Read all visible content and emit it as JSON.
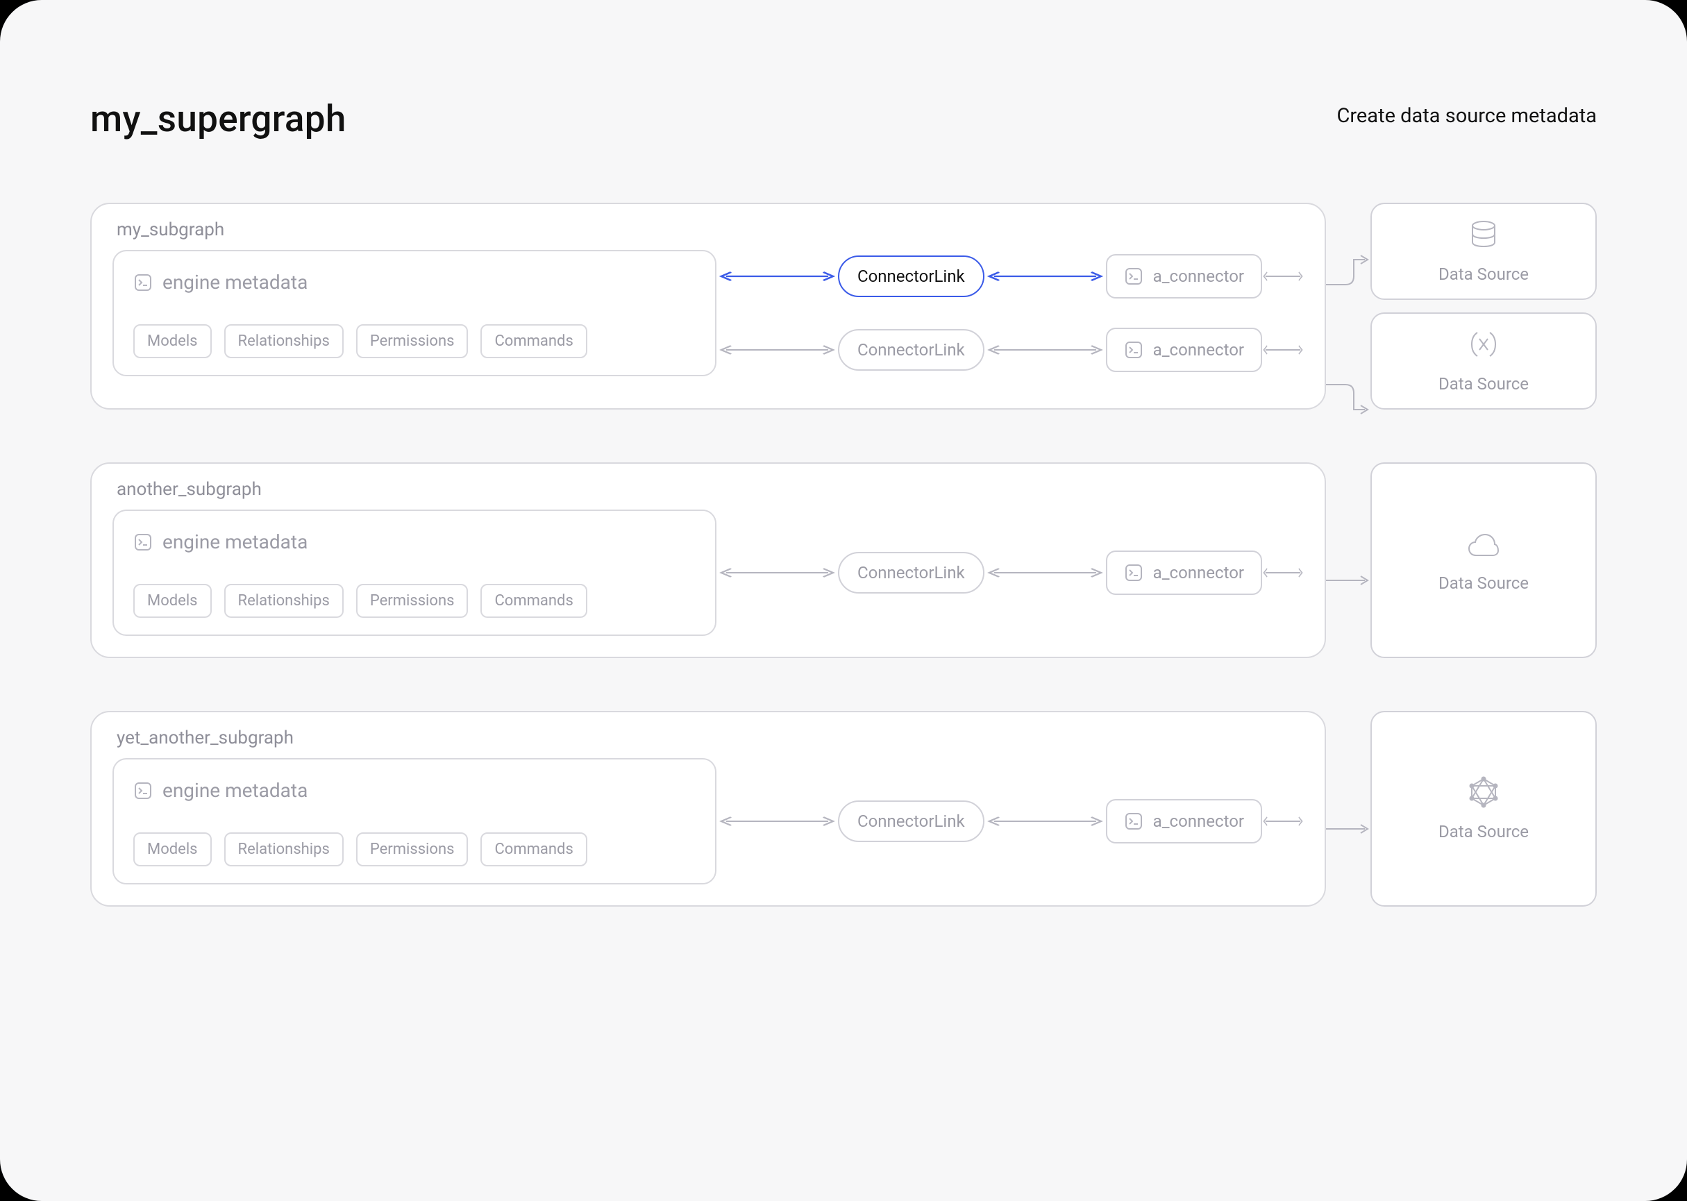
{
  "header": {
    "title": "my_supergraph",
    "subtitle": "Create data source metadata"
  },
  "connector_link_label": "ConnectorLink",
  "a_connector_label": "a_connector",
  "data_source_label": "Data Source",
  "engine_metadata_label": "engine metadata",
  "chip_labels": {
    "models": "Models",
    "relationships": "Relationships",
    "permissions": "Permissions",
    "commands": "Commands"
  },
  "subgraphs": [
    {
      "name": "my_subgraph",
      "lanes": 2,
      "active_lane": 0,
      "ds_icons": [
        "db",
        "var"
      ]
    },
    {
      "name": "another_subgraph",
      "lanes": 1,
      "ds_icons": [
        "cloud"
      ]
    },
    {
      "name": "yet_another_subgraph",
      "lanes": 1,
      "ds_icons": [
        "graphql"
      ]
    }
  ],
  "colors": {
    "accent": "#3b5be8",
    "muted": "#9b9ba5",
    "border": "#d1d1d8",
    "bg": "#f7f7f8"
  }
}
